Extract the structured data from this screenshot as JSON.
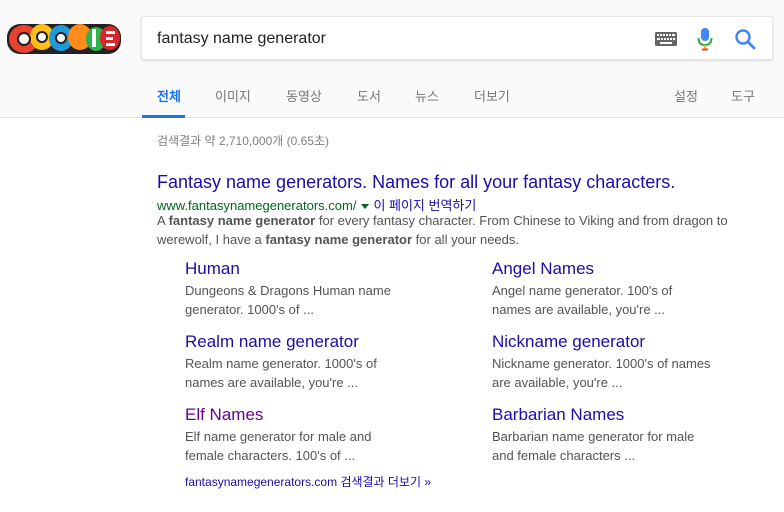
{
  "logo": {
    "alt": "Google"
  },
  "search": {
    "query": "fantasy name generator"
  },
  "tabs": [
    {
      "label": "전체"
    },
    {
      "label": "이미지"
    },
    {
      "label": "동영상"
    },
    {
      "label": "도서"
    },
    {
      "label": "뉴스"
    },
    {
      "label": "더보기"
    },
    {
      "label": "설정"
    },
    {
      "label": "도구"
    }
  ],
  "stats": "검색결과 약 2,710,000개 (0.65초)",
  "result": {
    "title": "Fantasy name generators. Names for all your fantasy characters.",
    "url": "www.fantasynamegenerators.com/",
    "translate": "이 페이지 번역하기",
    "snippet": {
      "p1": "A ",
      "b1": "fantasy name generator",
      "p2": " for every fantasy character. From Chinese to Viking and from dragon to",
      "p3": "werewolf, I have a ",
      "b2": "fantasy name generator",
      "p4": " for all your needs."
    }
  },
  "sitelinks": [
    {
      "title": "Human",
      "line1": "Dungeons & Dragons Human name",
      "line2": "generator. 1000's of ..."
    },
    {
      "title": "Angel Names",
      "line1": "Angel name generator. 100's of",
      "line2": "names are available, you're ..."
    },
    {
      "title": "Realm name generator",
      "line1": "Realm name generator. 1000's of",
      "line2": "names are available, you're ..."
    },
    {
      "title": "Nickname generator",
      "line1": "Nickname generator. 1000's of names",
      "line2": "are available, you're ..."
    },
    {
      "title": "Elf Names",
      "line1": "Elf name generator for male and",
      "line2": "female characters. 100's of ..."
    },
    {
      "title": "Barbarian Names",
      "line1": "Barbarian name generator for male",
      "line2": "and female characters ..."
    }
  ],
  "more": {
    "domain": "fantasynamegenerators.com",
    "label": "검색결과 더보기 »"
  },
  "colors": {
    "link": "#1a0dab",
    "visited": "#660099",
    "url": "#006621",
    "accent": "#1a73e8"
  }
}
